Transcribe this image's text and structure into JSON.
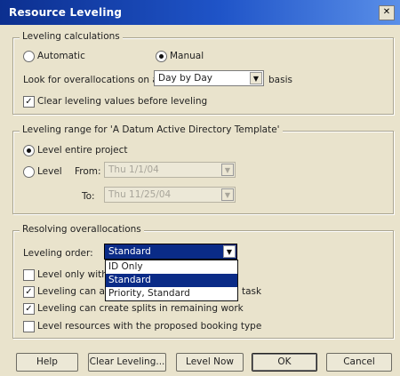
{
  "window": {
    "title": "Resource Leveling",
    "close_glyph": "✕"
  },
  "calc": {
    "legend": "Leveling calculations",
    "automatic_label": "Automatic",
    "manual_label": "Manual",
    "manual_selected": true,
    "overalloc_label": "Look for overallocations on a",
    "overalloc_value": "Day by Day",
    "basis_label": "basis",
    "clear_label": "Clear leveling values before leveling",
    "clear_checked": true
  },
  "range": {
    "legend": "Leveling range for 'A Datum Active Directory Template'",
    "entire_label": "Level entire project",
    "level_label": "Level",
    "from_label": "From:",
    "from_value": "Thu 1/1/04",
    "to_label": "To:",
    "to_value": "Thu 11/25/04"
  },
  "resolve": {
    "legend": "Resolving overallocations",
    "order_label": "Leveling order:",
    "order_value": "Standard",
    "dropdown_options": [
      "ID Only",
      "Standard",
      "Priority, Standard"
    ],
    "dropdown_selected_index": 1,
    "opt1_label": "Level only witha",
    "opt2_label": "Leveling can ad",
    "opt2_tail": "task",
    "opt3_label": "Leveling can create splits in remaining work",
    "opt4_label": "Level resources with the proposed booking type",
    "opt1_checked": false,
    "opt2_checked": true,
    "opt3_checked": true,
    "opt4_checked": false
  },
  "buttons": {
    "help": "Help",
    "clear_leveling": "Clear Leveling...",
    "level_now": "Level Now",
    "ok": "OK",
    "cancel": "Cancel"
  },
  "icons": {
    "check": "✓",
    "arrow": "▼"
  }
}
